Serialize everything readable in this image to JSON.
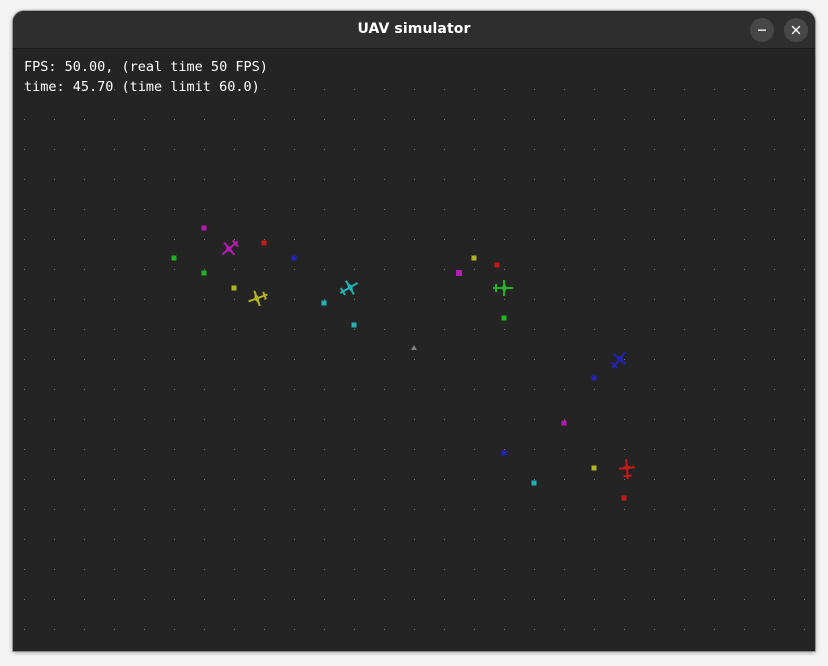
{
  "window": {
    "title": "UAV simulator",
    "minimize_icon": "minimize-icon",
    "close_icon": "close-icon"
  },
  "hud": {
    "fps_line": "FPS: 50.00, (real time 50 FPS)",
    "time_line": "time: 45.70 (time limit 60.0)"
  },
  "colors": {
    "background": "#242424",
    "grid_dot": "#7a7a7a",
    "magenta": "#b31db3",
    "red": "#c41a1a",
    "green": "#22b322",
    "yellow": "#b3b322",
    "blue": "#2222b8",
    "cyan": "#22b3b3",
    "origin_marker": "#7d7d7d"
  },
  "uavs": [
    {
      "name": "uav-magenta",
      "color": "magenta",
      "icon": "plane-icon"
    },
    {
      "name": "uav-yellow",
      "color": "yellow",
      "icon": "plane-icon"
    },
    {
      "name": "uav-cyan",
      "color": "cyan",
      "icon": "plane-icon"
    },
    {
      "name": "uav-green",
      "color": "green",
      "icon": "plane-icon"
    },
    {
      "name": "uav-blue",
      "color": "blue",
      "icon": "plane-icon"
    },
    {
      "name": "uav-red",
      "color": "red",
      "icon": "plane-icon"
    }
  ],
  "targets": [
    {
      "name": "target-magenta",
      "color": "magenta"
    },
    {
      "name": "target-red",
      "color": "red"
    },
    {
      "name": "target-green",
      "color": "green"
    },
    {
      "name": "target-green",
      "color": "green"
    },
    {
      "name": "target-yellow",
      "color": "yellow"
    },
    {
      "name": "target-blue",
      "color": "blue"
    },
    {
      "name": "target-cyan",
      "color": "cyan"
    },
    {
      "name": "target-cyan",
      "color": "cyan"
    },
    {
      "name": "target-magenta",
      "color": "magenta"
    },
    {
      "name": "target-yellow",
      "color": "yellow"
    },
    {
      "name": "target-red",
      "color": "red"
    },
    {
      "name": "target-green",
      "color": "green"
    },
    {
      "name": "target-blue",
      "color": "blue"
    },
    {
      "name": "target-magenta",
      "color": "magenta"
    },
    {
      "name": "target-blue",
      "color": "blue"
    },
    {
      "name": "target-yellow",
      "color": "yellow"
    },
    {
      "name": "target-cyan",
      "color": "cyan"
    },
    {
      "name": "target-red",
      "color": "red"
    }
  ]
}
